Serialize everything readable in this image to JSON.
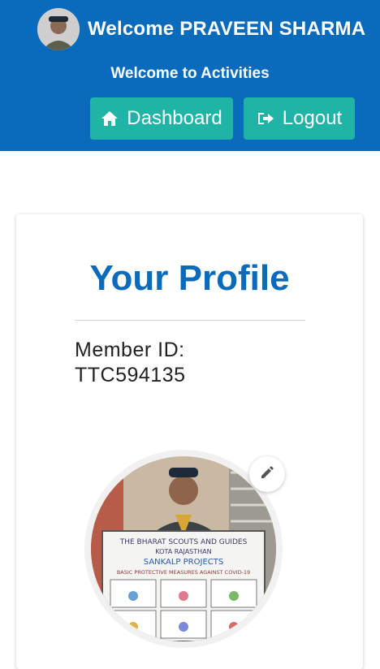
{
  "header": {
    "welcome_text": "Welcome PRAVEEN SHARMA",
    "subtitle": "Welcome to Activities",
    "dashboard_label": "Dashboard",
    "logout_label": "Logout"
  },
  "profile": {
    "title": "Your Profile",
    "member_id_label": "Member ID:",
    "member_id_value": "TTC594135",
    "photo_poster_lines": [
      "THE BHARAT SCOUTS AND GUIDES",
      "KOTA RAJASTHAN",
      "SANKALP PROJECTS",
      "BASIC PROTECTIVE MEASURES AGAINST COVID-19"
    ]
  },
  "colors": {
    "header_bg": "#0a6bbd",
    "button_bg": "#20b4a6",
    "title_color": "#0a6bbd"
  },
  "icons": {
    "dashboard": "home-icon",
    "logout": "sign-out-icon",
    "edit": "pencil-icon"
  }
}
